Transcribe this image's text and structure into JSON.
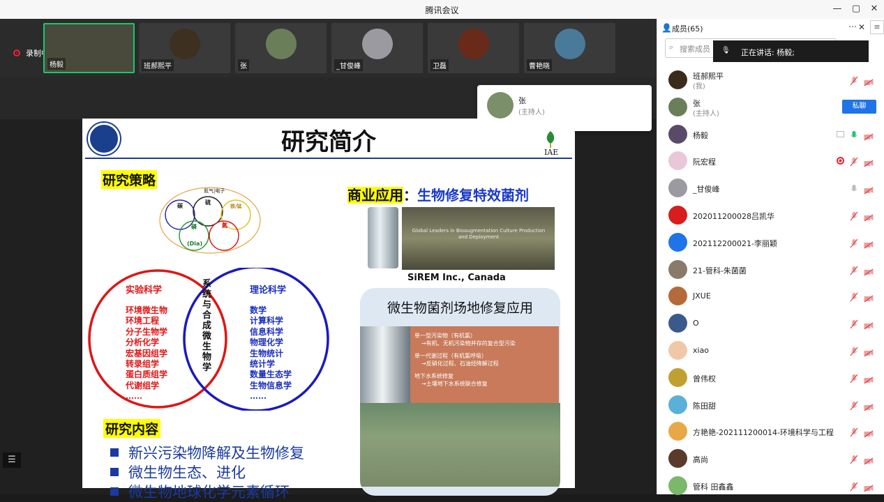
{
  "window": {
    "title": "腾讯会议",
    "minimize": "—",
    "restore": "▢",
    "close": "✕"
  },
  "recording": {
    "label": "录制中"
  },
  "video_tiles": [
    {
      "name": "杨毅",
      "color": "#4a4a3c"
    },
    {
      "name": "班郝熙平",
      "color": "#3d3020"
    },
    {
      "name": "张",
      "color": "#6b7e5a"
    },
    {
      "name": "_甘俊峰",
      "color": "#9a9aa0"
    },
    {
      "name": "卫磊",
      "color": "#6a2a1a"
    },
    {
      "name": "曹艳晓",
      "color": "#4a7a9a"
    }
  ],
  "notification": {
    "name": "张",
    "role": "(主持人)"
  },
  "slide": {
    "title": "研究简介",
    "logo_right": "IAE",
    "strategy": "研究策略",
    "application_prefix": "商业应用",
    "application_colon": "：",
    "application_suffix": "生物修复特效菌剂",
    "venn_top_labels": {
      "outer": "氮气|电子",
      "c1": "碳",
      "c2": "硫",
      "c3": "铁/锰",
      "c4": "氮",
      "c5": "磷",
      "center": "(Dia)"
    },
    "experimental": {
      "title": "实验科学",
      "items": [
        "环境微生物",
        "环境工程",
        "分子生物学",
        "分析化学",
        "宏基因组学",
        "转录组学",
        "蛋白质组学",
        "代谢组学",
        "……"
      ]
    },
    "theory": {
      "title": "理论科学",
      "items": [
        "数学",
        "计算科学",
        "信息科学",
        "物理化学",
        "生物统计",
        "统计学",
        "数量生态学",
        "生物信息学",
        "……"
      ]
    },
    "center_text": "系统与合成微生物学",
    "company": "SiREM Inc., Canada",
    "photo_banner": "Global Leaders in Bioaugmentation Culture Production and Deployment",
    "field_title": "微生物菌剂场地修复应用",
    "field_items": [
      {
        "head": "单一型污染物（有机氯）",
        "sub": "→有机、无机污染物并存的复合型污染"
      },
      {
        "head": "单一代谢过程（有机氯呼吸）",
        "sub": "→反硝化过程、石油烃降解过程"
      },
      {
        "head": "地下水系统修复",
        "sub": "→土壤地下水系统联合修复"
      }
    ],
    "content_title": "研究内容",
    "content_items": [
      "新兴污染物降解及生物修复",
      "微生物生态、进化",
      "微生物地球化学元素循环"
    ]
  },
  "panel": {
    "header": "成员(65)",
    "search_placeholder": "搜索成员",
    "speaking": "正在讲话: 杨毅;",
    "chat_button": "私聊",
    "members": [
      {
        "name": "班郝熙平",
        "role": "(我)",
        "color": "#3a2c1c"
      },
      {
        "name": "张",
        "role": "(主持人)",
        "color": "#6b7e5a"
      },
      {
        "name": "杨毅",
        "role": "",
        "color": "#5a4a6a"
      },
      {
        "name": "阮宏程",
        "role": "",
        "color": "#e8c8d8"
      },
      {
        "name": "_甘俊峰",
        "role": "",
        "color": "#9a9aa0"
      },
      {
        "name": "202011200028吕凯华",
        "role": "",
        "color": "#d91c1c"
      },
      {
        "name": "202112200021-李丽颖",
        "role": "",
        "color": "#1e74e8"
      },
      {
        "name": "21-管科-朱菌菌",
        "role": "",
        "color": "#8a7a6a"
      },
      {
        "name": "JXUE",
        "role": "",
        "color": "#b46a3a"
      },
      {
        "name": "O",
        "role": "",
        "color": "#3a5a8a"
      },
      {
        "name": "xiao",
        "role": "",
        "color": "#f0c8a8"
      },
      {
        "name": "曾伟权",
        "role": "",
        "color": "#c0a030"
      },
      {
        "name": "陈田甜",
        "role": "",
        "color": "#5ab0d8"
      },
      {
        "name": "方艳艳-202111200014-环境科学与工程",
        "role": "",
        "color": "#e8a848"
      },
      {
        "name": "高尚",
        "role": "",
        "color": "#5a3a2a"
      },
      {
        "name": "管科 田鑫鑫",
        "role": "",
        "color": "#7ab86a"
      }
    ]
  }
}
